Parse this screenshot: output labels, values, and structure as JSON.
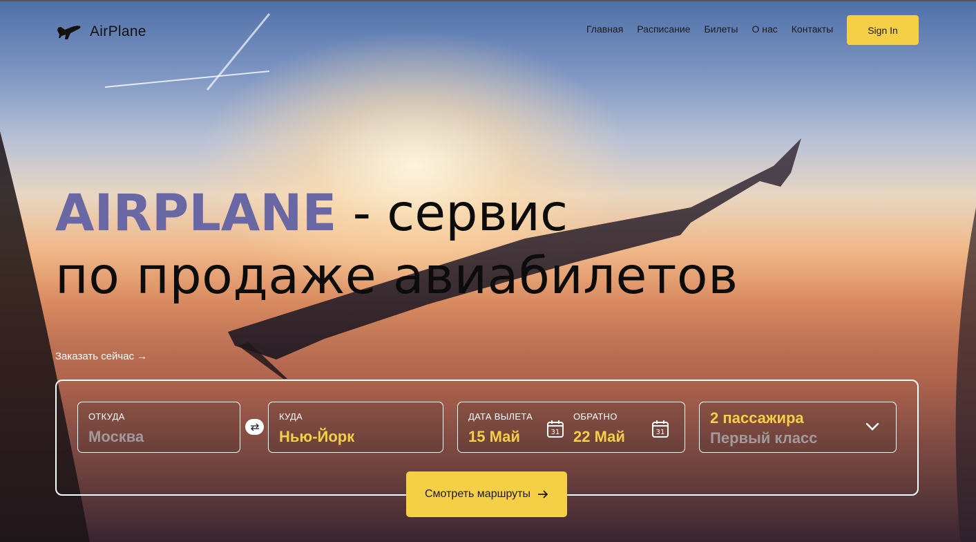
{
  "brand": {
    "name": "AirPlane"
  },
  "nav": {
    "items": [
      "Главная",
      "Расписание",
      "Билеты",
      "О нас",
      "Контакты"
    ],
    "sign_in": "Sign In"
  },
  "hero": {
    "accent": "AIRPLANE",
    "title_rest": " - сервис",
    "title_line2": "по продаже авиабилетов",
    "cta": "Заказать сейчас →"
  },
  "search": {
    "from": {
      "label": "ОТКУДА",
      "value": "Москва"
    },
    "to": {
      "label": "КУДА",
      "value": "Нью-Йорк"
    },
    "departure": {
      "label": "ДАТА ВЫЛЕТА",
      "value": "15 Май"
    },
    "return": {
      "label": "ОБРАТНО",
      "value": "22 Май"
    },
    "passengers": {
      "count": "2 пассажира",
      "class": "Первый класс"
    },
    "calendar_day": "31",
    "submit": "Смотреть маршруты"
  },
  "colors": {
    "accent": "#6a68a4",
    "button": "#f5d046",
    "value_highlight": "#f5d046"
  }
}
